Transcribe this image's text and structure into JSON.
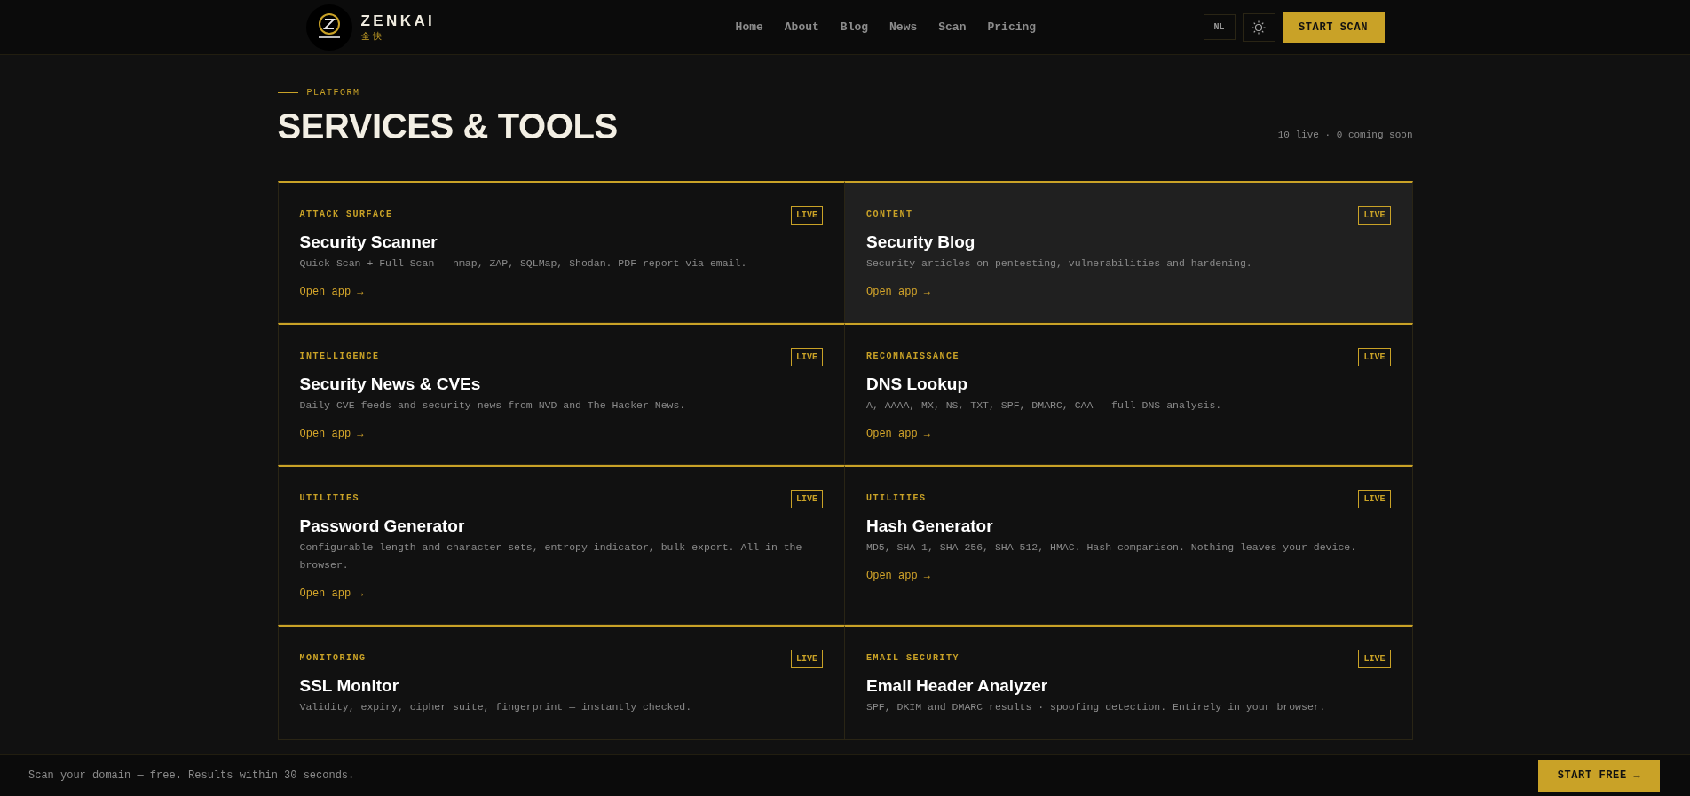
{
  "header": {
    "brand": {
      "name": "ZENKAI",
      "subtitle": "全 快"
    },
    "nav": [
      {
        "label": "Home"
      },
      {
        "label": "About"
      },
      {
        "label": "Blog"
      },
      {
        "label": "News"
      },
      {
        "label": "Scan"
      },
      {
        "label": "Pricing"
      }
    ],
    "language": "NL",
    "cta": "START SCAN"
  },
  "section": {
    "eyebrow": "PLATFORM",
    "title": "SERVICES & TOOLS",
    "summary": "10 live · 0 coming soon"
  },
  "cards": [
    {
      "category": "ATTACK SURFACE",
      "title": "Security Scanner",
      "description": "Quick Scan + Full Scan — nmap, ZAP, SQLMap, Shodan. PDF report via email.",
      "link": "Open app →",
      "badge": "LIVE",
      "highlighted": false
    },
    {
      "category": "CONTENT",
      "title": "Security Blog",
      "description": "Security articles on pentesting, vulnerabilities and hardening.",
      "link": "Open app →",
      "badge": "LIVE",
      "highlighted": true
    },
    {
      "category": "INTELLIGENCE",
      "title": "Security News & CVEs",
      "description": "Daily CVE feeds and security news from NVD and The Hacker News.",
      "link": "Open app →",
      "badge": "LIVE",
      "highlighted": false
    },
    {
      "category": "RECONNAISSANCE",
      "title": "DNS Lookup",
      "description": "A, AAAA, MX, NS, TXT, SPF, DMARC, CAA — full DNS analysis.",
      "link": "Open app →",
      "badge": "LIVE",
      "highlighted": false
    },
    {
      "category": "UTILITIES",
      "title": "Password Generator",
      "description": "Configurable length and character sets, entropy indicator, bulk export. All in the browser.",
      "link": "Open app →",
      "badge": "LIVE",
      "highlighted": false
    },
    {
      "category": "UTILITIES",
      "title": "Hash Generator",
      "description": "MD5, SHA-1, SHA-256, SHA-512, HMAC. Hash comparison. Nothing leaves your device.",
      "link": "Open app →",
      "badge": "LIVE",
      "highlighted": false
    },
    {
      "category": "MONITORING",
      "title": "SSL Monitor",
      "description": "Validity, expiry, cipher suite, fingerprint — instantly checked.",
      "badge": "LIVE",
      "highlighted": false
    },
    {
      "category": "EMAIL SECURITY",
      "title": "Email Header Analyzer",
      "description": "SPF, DKIM and DMARC results · spoofing detection. Entirely in your browser.",
      "badge": "LIVE",
      "highlighted": false
    }
  ],
  "footer_bar": {
    "text": "Scan your domain — free. Results within 30 seconds.",
    "cta": "START FREE →"
  }
}
